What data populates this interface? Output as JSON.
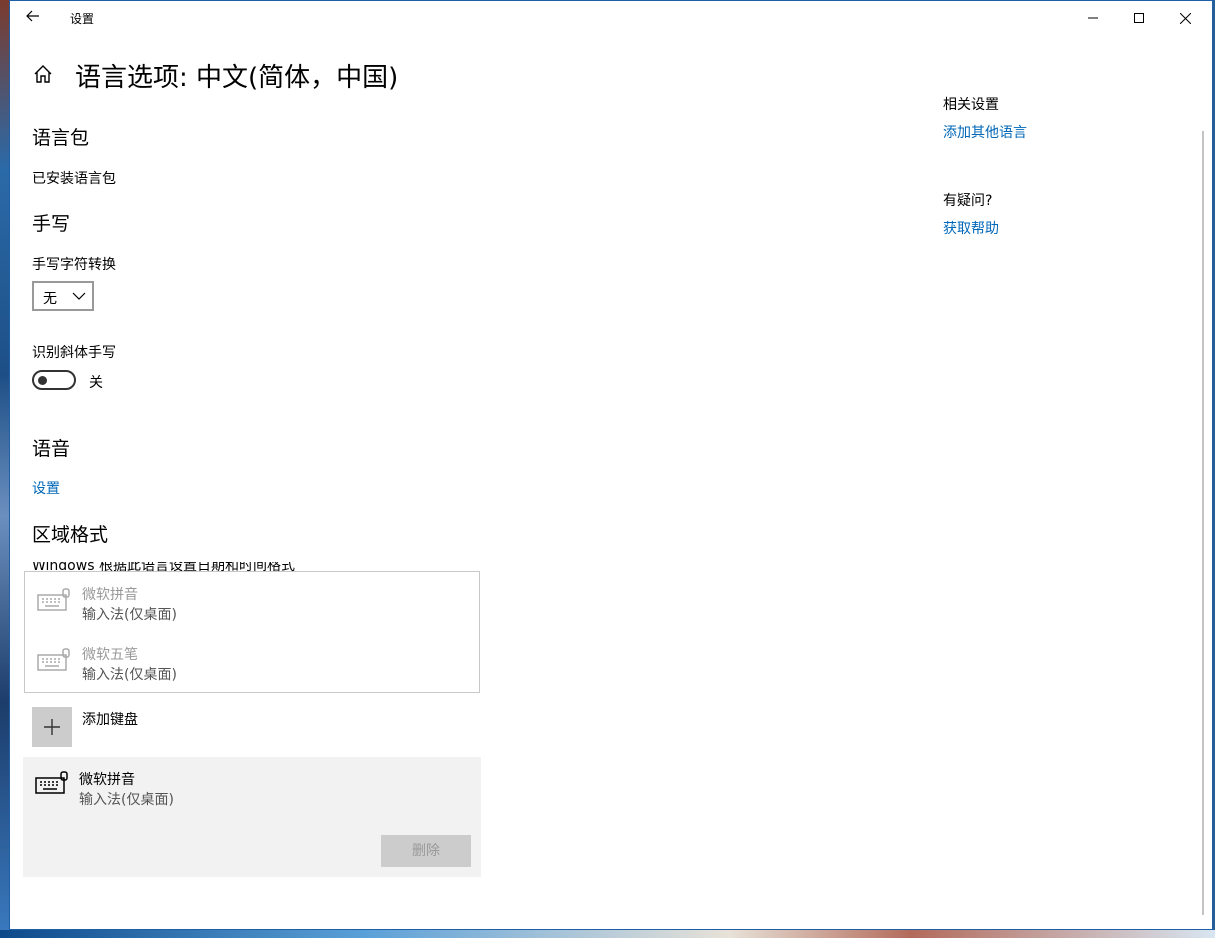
{
  "window": {
    "title": "设置"
  },
  "page": {
    "title": "语言选项: 中文(简体，中国)"
  },
  "sections": {
    "language_pack": {
      "heading": "语言包",
      "status": "已安装语言包"
    },
    "handwriting": {
      "heading": "手写",
      "char_conversion_label": "手写字符转换",
      "char_conversion_value": "无",
      "italic_label": "识别斜体手写",
      "italic_state": "关"
    },
    "speech": {
      "heading": "语音",
      "settings_link": "设置"
    },
    "regional_format": {
      "heading": "区域格式",
      "clipped_text": "Windows 根据此语言设置日期和时间格式"
    }
  },
  "keyboard_popup": {
    "items": [
      {
        "name": "微软拼音",
        "sub": "输入法(仅桌面)"
      },
      {
        "name": "微软五笔",
        "sub": "输入法(仅桌面)"
      }
    ]
  },
  "add_keyboard": {
    "label": "添加键盘"
  },
  "installed_keyboard": {
    "name": "微软拼音",
    "sub": "输入法(仅桌面)",
    "delete_label": "删除"
  },
  "related": {
    "heading": "相关设置",
    "add_language_link": "添加其他语言",
    "question_heading": "有疑问?",
    "help_link": "获取帮助"
  },
  "colors": {
    "accent": "#0067b8",
    "card_bg": "#f2f2f2",
    "disabled_button": "#cccccc"
  }
}
